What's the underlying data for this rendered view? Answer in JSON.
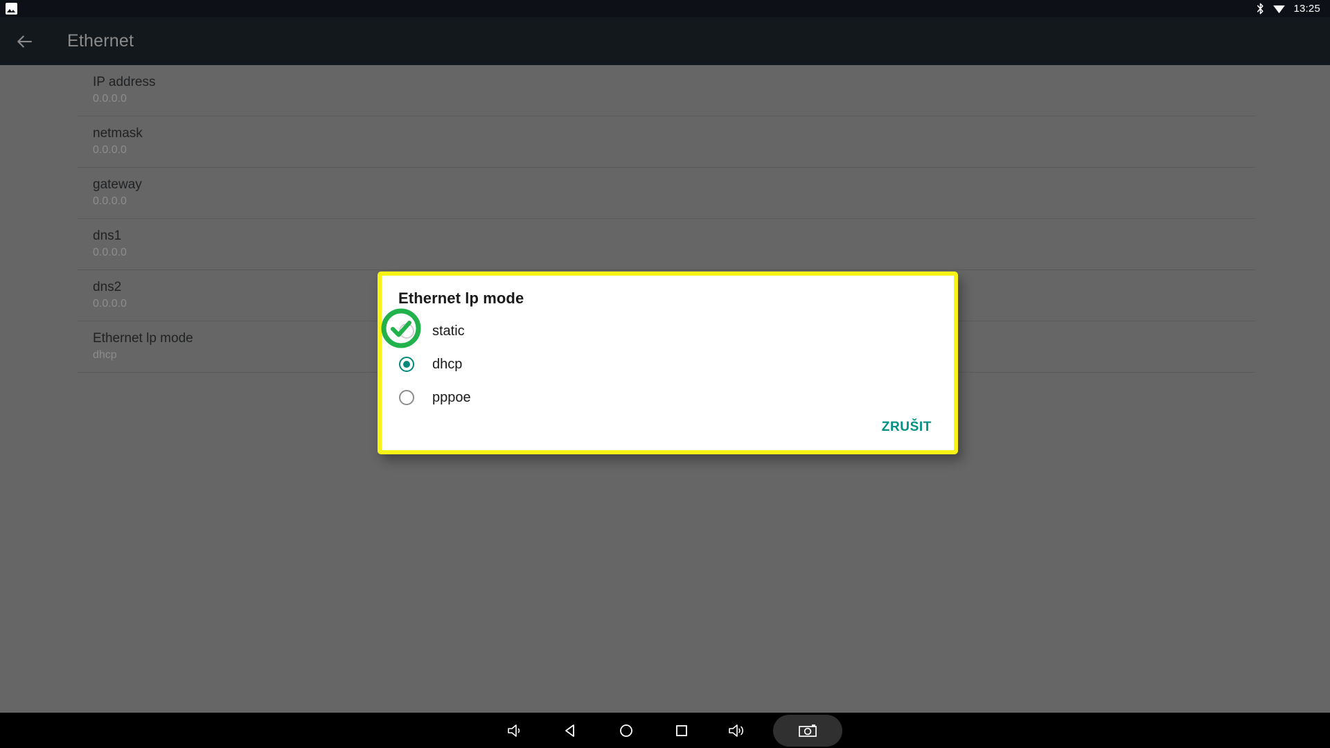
{
  "status_bar": {
    "notification_icon": "screenshot-image-icon",
    "bluetooth_icon": "bluetooth-icon",
    "wifi_icon": "wifi-signal-icon",
    "time": "13:25"
  },
  "app_bar": {
    "back_icon": "back-arrow-icon",
    "title": "Ethernet"
  },
  "settings_list": [
    {
      "title": "IP address",
      "value": "0.0.0.0"
    },
    {
      "title": "netmask",
      "value": "0.0.0.0"
    },
    {
      "title": "gateway",
      "value": "0.0.0.0"
    },
    {
      "title": "dns1",
      "value": "0.0.0.0"
    },
    {
      "title": "dns2",
      "value": "0.0.0.0"
    },
    {
      "title": "Ethernet lp mode",
      "value": "dhcp"
    }
  ],
  "dialog": {
    "title": "Ethernet lp mode",
    "options": [
      {
        "label": "static",
        "selected": false
      },
      {
        "label": "dhcp",
        "selected": true
      },
      {
        "label": "pppoe",
        "selected": false
      }
    ],
    "cancel_label": "ZRUŠIT",
    "border_color": "#f7f415",
    "accent_color": "#009183",
    "cursor_highlight_color": "#22b24c"
  },
  "nav_bar": {
    "buttons": [
      "volume-down-icon",
      "back-icon",
      "home-icon",
      "recents-icon",
      "volume-up-icon",
      "screenshot-camera-icon"
    ]
  }
}
